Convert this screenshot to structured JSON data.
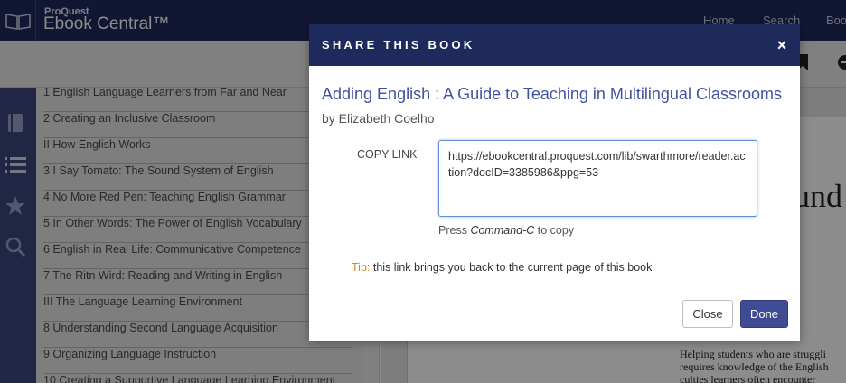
{
  "header": {
    "brand_small": "ProQuest",
    "brand_big": "Ebook Central™",
    "nav": [
      "Home",
      "Search",
      "Boo"
    ]
  },
  "toc": {
    "items": [
      "1 English Language Learners from Far and Near",
      "2 Creating an Inclusive Classroom",
      "II How English Works",
      "3 I Say Tomato: The Sound System of English",
      "4 No More Red Pen: Teaching English Grammar",
      "5 In Other Words: The Power of English Vocabulary",
      "6 English in Real Life: Communicative Competence",
      "7 The Ritn Wird: Reading and Writing in English",
      "III The Language Learning Environment",
      "8 Understanding Second Language Acquisition",
      "9 Organizing Language Instruction",
      "10 Creating a Supportive Language Learning Environment"
    ]
  },
  "reader": {
    "heading_fragment": "und",
    "text_lines": [
      "Helping students who are struggli",
      "requires knowledge of the English",
      "culties  learners  often  encounter"
    ]
  },
  "modal": {
    "title": "SHARE THIS BOOK",
    "close_x": "×",
    "book_title": "Adding English : A Guide to Teaching in Multilingual Classrooms",
    "author": "by Elizabeth Coelho",
    "copy_label": "COPY LINK",
    "link": "https://ebookcentral.proquest.com/lib/swarthmore/reader.action?docID=3385986&ppg=53",
    "press_prefix": "Press ",
    "press_command": "Command-C",
    "press_suffix": " to copy",
    "tip_label": "Tip:",
    "tip_text": " this link brings you back to the current page of this book",
    "close_button": "Close",
    "done_button": "Done"
  },
  "colors": {
    "header_bg": "#1f2a5c",
    "accent": "#3f51a3",
    "done_bg": "#3f4b94",
    "tip": "#d9822b"
  },
  "icons": [
    "book-icon",
    "toc-list-icon",
    "star-icon",
    "search-icon",
    "bookmark-icon"
  ]
}
